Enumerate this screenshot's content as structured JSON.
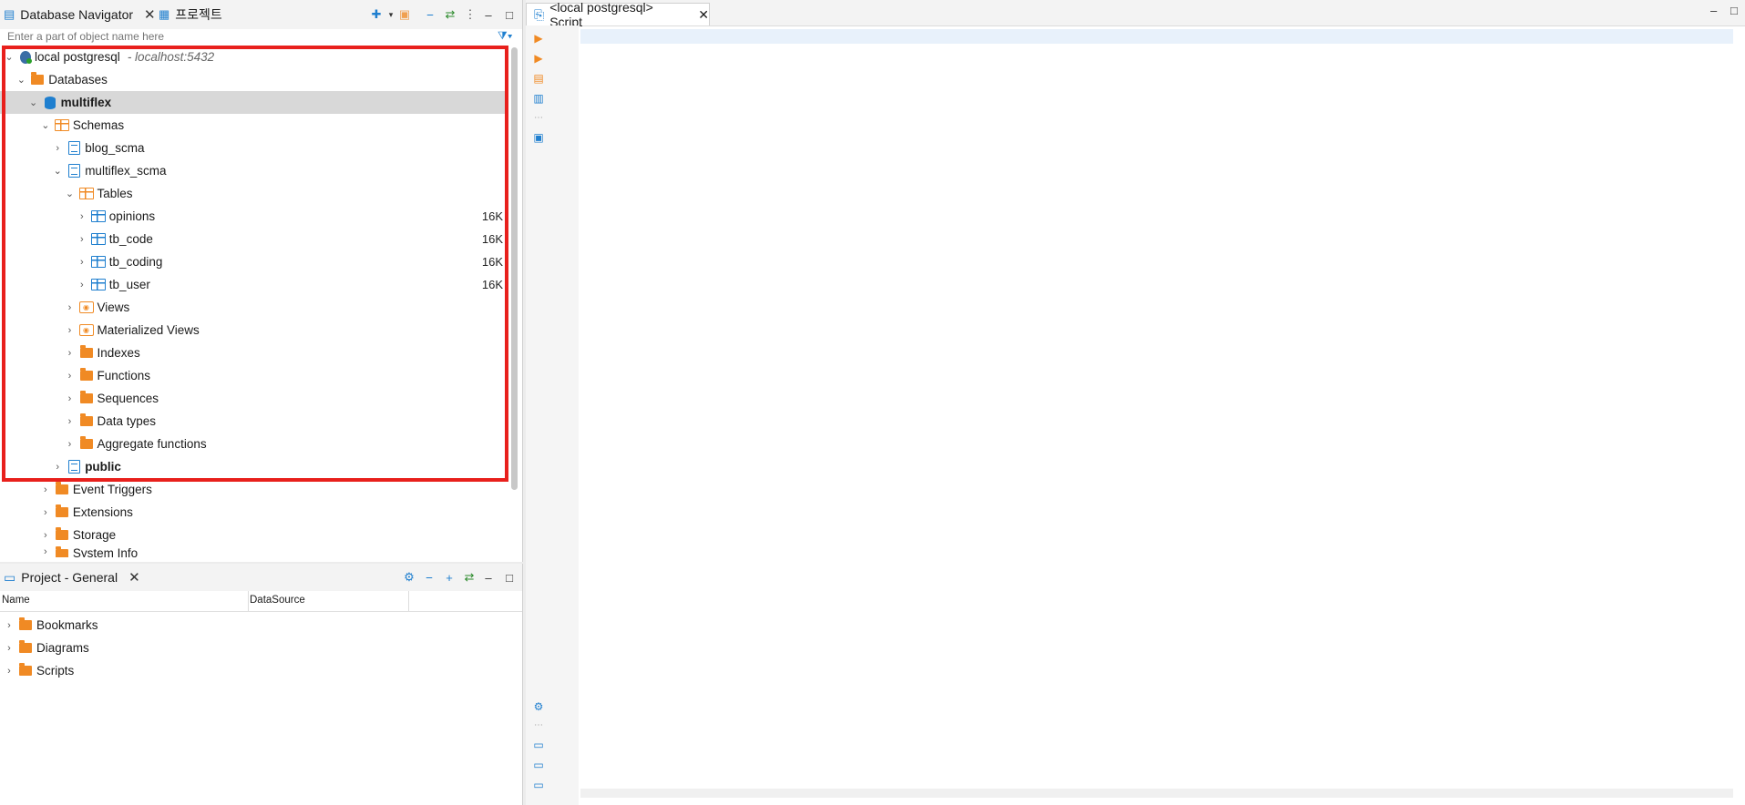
{
  "navigator": {
    "tab_label": "Database Navigator",
    "tab2_label": "프로젝트",
    "filter_placeholder": "Enter a part of object name here",
    "connection": {
      "name": "local postgresql",
      "host": "- localhost:5432"
    },
    "tree": [
      {
        "label": "Databases",
        "level": 1,
        "open": true,
        "icon": "folder-icon"
      },
      {
        "label": "multiflex",
        "level": 2,
        "open": true,
        "icon": "database-icon",
        "bold": true,
        "selected": true
      },
      {
        "label": "Schemas",
        "level": 3,
        "open": true,
        "icon": "schemas-icon"
      },
      {
        "label": "blog_scma",
        "level": 4,
        "open": false,
        "icon": "schema-icon"
      },
      {
        "label": "multiflex_scma",
        "level": 4,
        "open": true,
        "icon": "schema-icon"
      },
      {
        "label": "Tables",
        "level": 5,
        "open": true,
        "icon": "tables-icon"
      },
      {
        "label": "opinions",
        "level": 6,
        "open": false,
        "icon": "table-icon",
        "size": "16K"
      },
      {
        "label": "tb_code",
        "level": 6,
        "open": false,
        "icon": "table-icon",
        "size": "16K"
      },
      {
        "label": "tb_coding",
        "level": 6,
        "open": false,
        "icon": "table-icon",
        "size": "16K"
      },
      {
        "label": "tb_user",
        "level": 6,
        "open": false,
        "icon": "table-icon",
        "size": "16K"
      },
      {
        "label": "Views",
        "level": 5,
        "open": false,
        "icon": "view-icon"
      },
      {
        "label": "Materialized Views",
        "level": 5,
        "open": false,
        "icon": "view-icon"
      },
      {
        "label": "Indexes",
        "level": 5,
        "open": false,
        "icon": "folder-icon"
      },
      {
        "label": "Functions",
        "level": 5,
        "open": false,
        "icon": "folder-icon"
      },
      {
        "label": "Sequences",
        "level": 5,
        "open": false,
        "icon": "folder-icon"
      },
      {
        "label": "Data types",
        "level": 5,
        "open": false,
        "icon": "folder-icon"
      },
      {
        "label": "Aggregate functions",
        "level": 5,
        "open": false,
        "icon": "folder-icon"
      },
      {
        "label": "public",
        "level": 4,
        "open": false,
        "icon": "schema-icon",
        "bold": true
      },
      {
        "label": "Event Triggers",
        "level": 3,
        "open": false,
        "icon": "folder-icon"
      },
      {
        "label": "Extensions",
        "level": 3,
        "open": false,
        "icon": "folder-icon"
      },
      {
        "label": "Storage",
        "level": 3,
        "open": false,
        "icon": "folder-icon"
      },
      {
        "label": "System Info",
        "level": 3,
        "open": false,
        "icon": "folder-icon"
      }
    ]
  },
  "project": {
    "tab_label": "Project - General",
    "columns": [
      "Name",
      "DataSource"
    ],
    "items": [
      "Bookmarks",
      "Diagrams",
      "Scripts"
    ]
  },
  "editor": {
    "tab_label": "<local postgresql> Script"
  },
  "colors": {
    "accent": "#1f7fcf",
    "folder": "#f08a24",
    "highlight": "#e8201c"
  }
}
